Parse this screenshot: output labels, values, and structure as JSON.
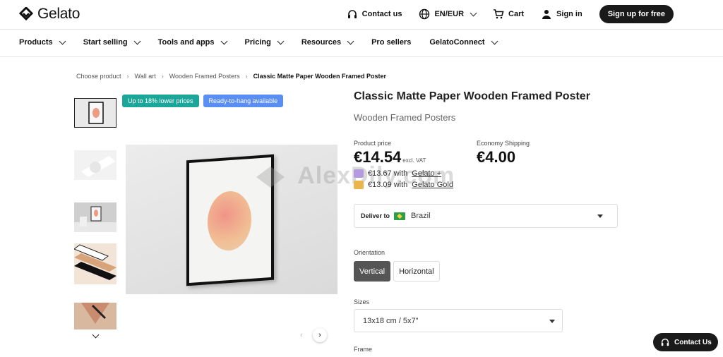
{
  "header": {
    "logo_text": "Gelato",
    "contact_label": "Contact us",
    "currency_label": "EN/EUR",
    "cart_label": "Cart",
    "signin_label": "Sign in",
    "signup_label": "Sign up for free"
  },
  "nav": {
    "items": [
      {
        "label": "Products",
        "has_chevron": true
      },
      {
        "label": "Start selling",
        "has_chevron": true
      },
      {
        "label": "Tools and apps",
        "has_chevron": true
      },
      {
        "label": "Pricing",
        "has_chevron": true
      },
      {
        "label": "Resources",
        "has_chevron": true
      },
      {
        "label": "Pro sellers",
        "has_chevron": false
      },
      {
        "label": "GelatoConnect",
        "has_chevron": true
      }
    ]
  },
  "breadcrumb": {
    "items": [
      "Choose product",
      "Wall art",
      "Wooden Framed Posters"
    ],
    "current": "Classic Matte Paper Wooden Framed Poster"
  },
  "badges": {
    "price_badge": "Up to 18% lower prices",
    "hang_badge": "Ready-to-hang available"
  },
  "product": {
    "title": "Classic Matte Paper Wooden Framed Poster",
    "subtitle": "Wooden Framed Posters",
    "price_label": "Product price",
    "price": "€14.54",
    "price_vat": "excl. VAT",
    "shipping_label": "Economy Shipping",
    "shipping_price": "€4.00",
    "plus_price": "€13.67 with",
    "plus_link": "Gelato +",
    "gold_price": "€13.09 with",
    "gold_link": "Gelato Gold"
  },
  "deliver": {
    "label": "Deliver to",
    "country": "Brazil"
  },
  "orientation": {
    "label": "Orientation",
    "options": [
      "Vertical",
      "Horizontal"
    ],
    "selected": "Vertical"
  },
  "sizes": {
    "label": "Sizes",
    "value": "13x18 cm / 5x7\""
  },
  "frame": {
    "label": "Frame"
  },
  "watermark": "AlexDily.com",
  "contact_float": "Contact Us",
  "colors": {
    "badge_green": "#1ca69a",
    "badge_blue": "#5b8ef3",
    "dark": "#1a1a1a"
  }
}
